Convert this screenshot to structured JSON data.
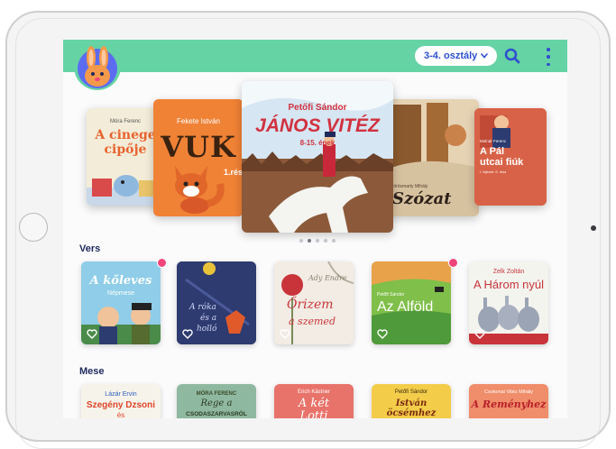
{
  "header": {
    "grade_label": "3-4. osztály",
    "icons": {
      "avatar": "bunny-avatar",
      "grade_chevron": "chevron-down-icon",
      "search": "search-icon",
      "more": "more-vertical-icon"
    },
    "accent": "#2f4fd0",
    "bar_color": "#66d3a4"
  },
  "carousel": {
    "items": [
      {
        "author": "Móra Ferenc",
        "title_line1": "A cinege",
        "title_line2": "cipője"
      },
      {
        "author": "Fekete István",
        "title": "VUK",
        "subtitle": "1.rész"
      },
      {
        "author": "Petőfi Sándor",
        "title": "JÁNOS VITÉZ",
        "subtitle": "8-15. ének"
      },
      {
        "author": "Vörösmarty Mihály",
        "title": "Szózat"
      },
      {
        "author": "Molnár Ferenc",
        "title_line1": "A Pál",
        "title_line2": "utcai fiúk",
        "subtitle": "I. fejezet. 6. rész"
      }
    ],
    "page_count": 5,
    "active_index": 1
  },
  "sections": [
    {
      "title": "Vers",
      "items": [
        {
          "title": "A kőleves",
          "subtitle": "Népmese",
          "new": true
        },
        {
          "title_line1": "A róka",
          "title_line2": "és a",
          "title_line3": "holló",
          "new": false
        },
        {
          "author": "Ady Endre",
          "title_line1": "Őrizem",
          "title_line2": "a szemed",
          "new": false
        },
        {
          "author": "Petőfi Sándor",
          "title": "Az Alföld",
          "new": true
        },
        {
          "author": "Zelk Zoltán",
          "title": "A Három nyúl",
          "new": false
        }
      ]
    },
    {
      "title": "Mese",
      "items": [
        {
          "author": "Lázár Ervin",
          "title_line1": "Szegény Dzsoni",
          "title_line2": "és"
        },
        {
          "author": "MÓRA FERENC",
          "title_line1": "Rege a",
          "title_line2": "CSODASZARVASRÓL"
        },
        {
          "author": "Erich Kästner",
          "title_line1": "A két",
          "title_line2": "Lotti"
        },
        {
          "author": "Petőfi Sándor",
          "title": "István öcsémhez"
        },
        {
          "author": "Csokonai Vitéz Mihály",
          "title": "A Reményhez"
        }
      ]
    }
  ]
}
